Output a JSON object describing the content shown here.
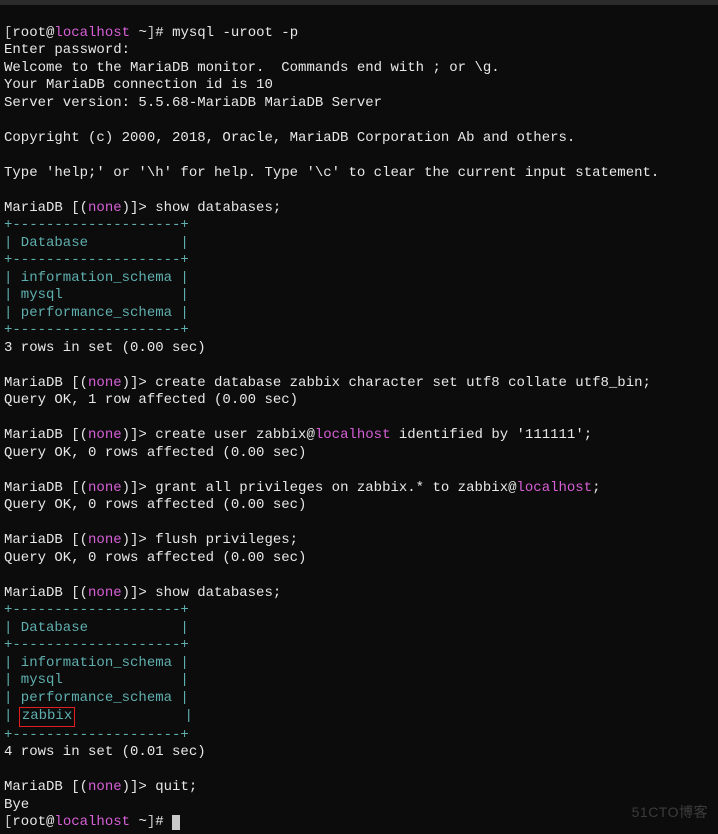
{
  "prompt": {
    "lb": "[",
    "user": "root",
    "at": "@",
    "host": "localhost",
    "tilde": " ~",
    "rb": "]",
    "hash": "# "
  },
  "cmd_mysql": "mysql -uroot -p",
  "enter_pw": "Enter password:",
  "welcome": "Welcome to the MariaDB monitor.  Commands end with ; or \\g.",
  "conn_id": "Your MariaDB connection id is 10",
  "version": "Server version: 5.5.68-MariaDB MariaDB Server",
  "copyright": "Copyright (c) 2000, 2018, Oracle, MariaDB Corporation Ab and others.",
  "help": "Type 'help;' or '\\h' for help. Type '\\c' to clear the current input statement.",
  "mdb": {
    "pre": "MariaDB [(",
    "none": "none",
    "post": ")]> "
  },
  "sql": {
    "show_db": "show databases;",
    "create_db_pre": "create database zabbix character set utf8 collate utf8_bin;",
    "create_user_pre": "create user zabbix@",
    "create_user_host": "localhost",
    "create_user_post": " identified by '111111';",
    "grant_pre": "grant all privileges on zabbix.* to zabbix@",
    "grant_host": "localhost",
    "grant_post": ";",
    "flush": "flush privileges;",
    "quit": "quit;"
  },
  "tbl": {
    "border": "+--------------------+",
    "header": "| Database           |",
    "r_info": "| information_schema |",
    "r_mysql": "| mysql              |",
    "r_perf": "| performance_schema |",
    "r_zbx_pre": "| ",
    "r_zbx_name": "zabbix",
    "r_zbx_post": "             |"
  },
  "result": {
    "rows3": "3 rows in set (0.00 sec)",
    "rows4": "4 rows in set (0.01 sec)",
    "ok1": "Query OK, 1 row affected (0.00 sec)",
    "ok0": "Query OK, 0 rows affected (0.00 sec)"
  },
  "bye": "Bye",
  "watermark": "51CTO博客"
}
